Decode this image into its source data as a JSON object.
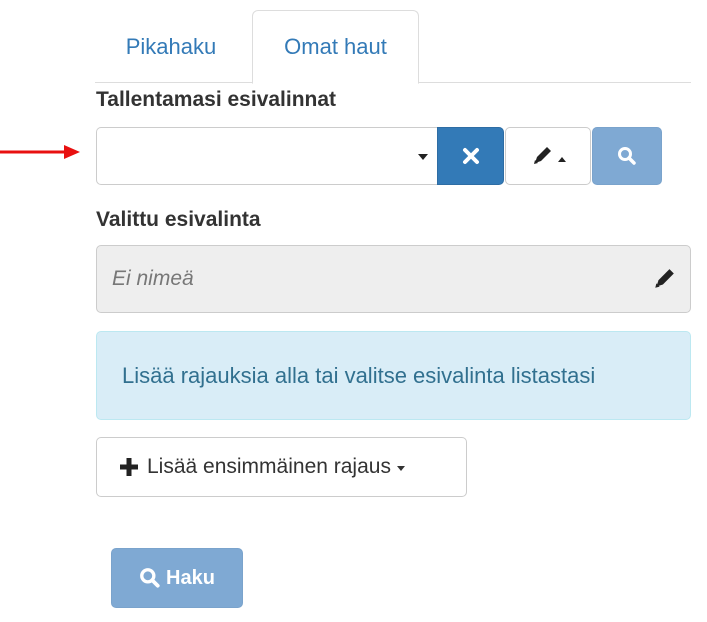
{
  "tabs": [
    {
      "label": "Pikahaku",
      "active": false
    },
    {
      "label": "Omat haut",
      "active": true
    }
  ],
  "saved_presets": {
    "label": "Tallentamasi esivalinnat",
    "selected_value": "",
    "clear_icon": "times-icon",
    "edit_menu_icon": "pencil-icon",
    "search_icon": "search-icon"
  },
  "selected_preset": {
    "label": "Valittu esivalinta",
    "name_placeholder": "Ei nimeä",
    "edit_icon": "pencil-icon"
  },
  "info_alert": {
    "text": "Lisää rajauksia alla tai valitse esivalinta listastasi"
  },
  "add_filter": {
    "label": "Lisää ensimmäinen rajaus",
    "icon": "plus-icon"
  },
  "search_button": {
    "label": "Haku",
    "icon": "search-icon"
  },
  "colors": {
    "primary": "#337ab7",
    "primary_disabled": "#7fa9d3",
    "info_bg": "#d9edf7",
    "info_text": "#31708f",
    "annotation_arrow": "#e81010"
  }
}
